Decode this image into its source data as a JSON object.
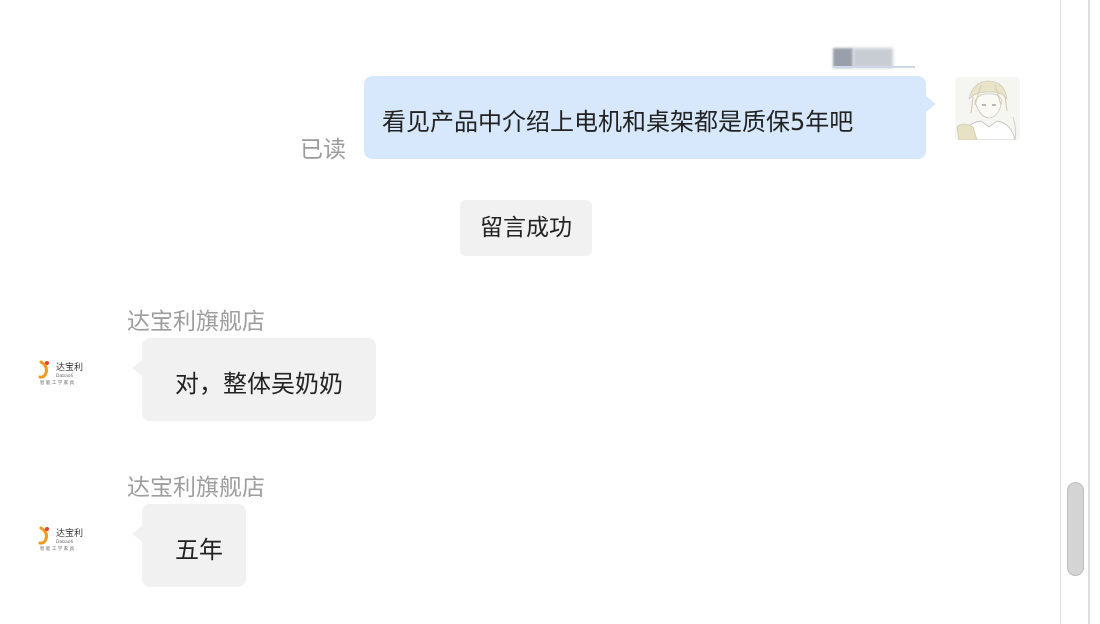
{
  "messages": {
    "outgoing": {
      "text": "看见产品中介绍上电机和桌架都是质保5年吧",
      "read_status": "已读"
    },
    "system_notice": "留言成功",
    "incoming": [
      {
        "sender": "达宝利旗舰店",
        "text": "对，整体吴奶奶"
      },
      {
        "sender": "达宝利旗舰店",
        "text": "五年"
      }
    ]
  },
  "shop_logo": {
    "brand_text": "达宝利",
    "brand_latin": "Dabaoli",
    "tagline": "智 能 工 学 家 具"
  },
  "icons": {
    "user_avatar": "user-avatar-illustration",
    "shop_logo": "shop-logo-icon"
  },
  "colors": {
    "outgoing_bubble": "#d7e8fd",
    "incoming_bubble": "#f1f1f1",
    "muted_text": "#9d9d9d",
    "logo_orange": "#f39a1e"
  }
}
